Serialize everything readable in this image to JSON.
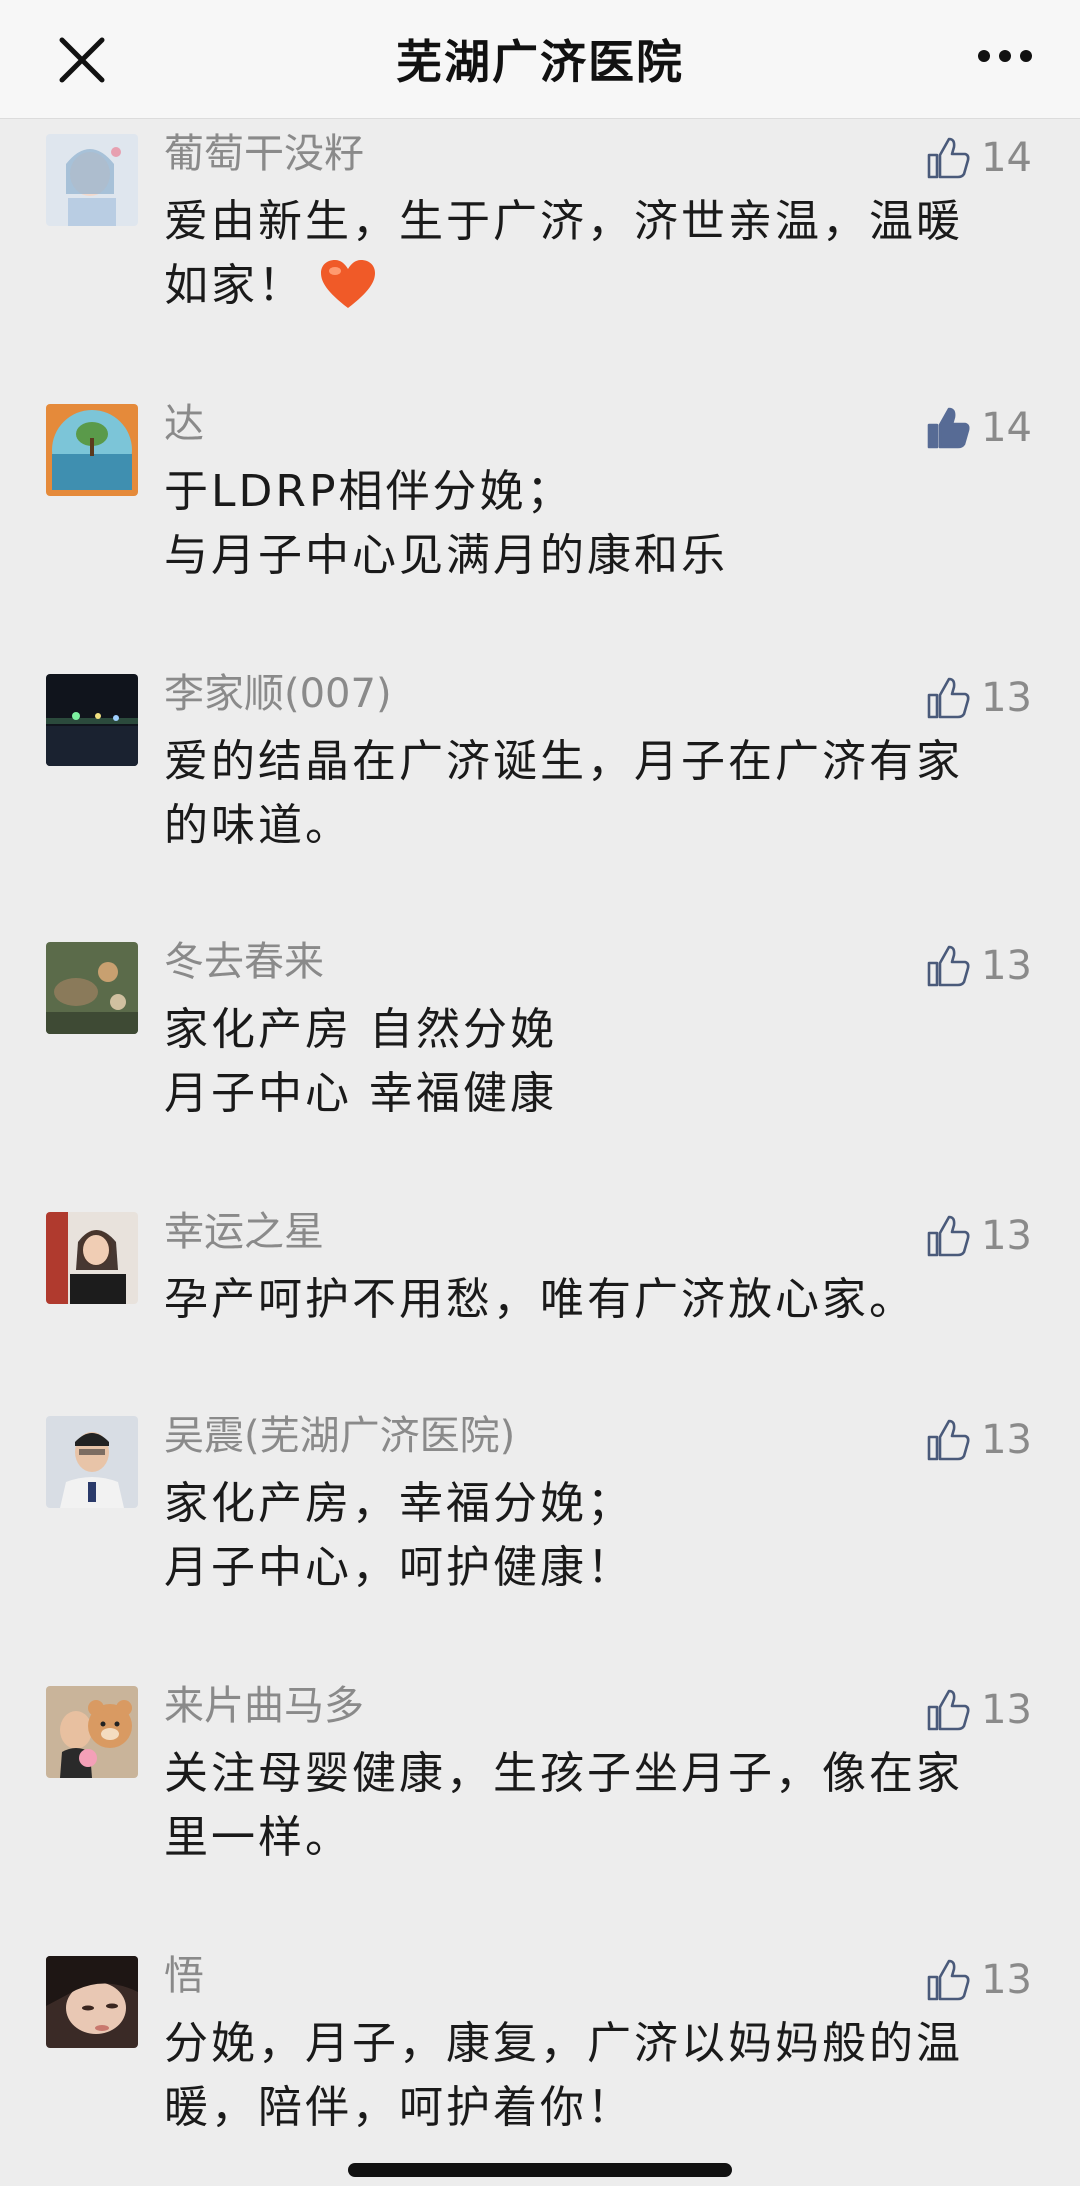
{
  "header": {
    "title": "芜湖广济医院",
    "close_icon": "close-icon",
    "more_icon": "more-dots-icon"
  },
  "colors": {
    "background": "#ededed",
    "header_bg": "#f7f7f7",
    "like_icon": "#4a5a7a",
    "liked_icon": "#576b95",
    "heart": "#f05a28"
  },
  "comments": [
    {
      "name": "葡萄干没籽",
      "likes": "14",
      "liked": false,
      "lines": [
        "爱由新生，生于广济，济世亲温，温暖",
        "如家！"
      ],
      "emoji": "heart"
    },
    {
      "name": "达",
      "likes": "14",
      "liked": true,
      "lines": [
        "于LDRP相伴分娩；",
        "与月子中心见满月的康和乐"
      ]
    },
    {
      "name": "李家顺(007)",
      "likes": "13",
      "liked": false,
      "lines": [
        "爱的结晶在广济诞生，月子在广济有家",
        "的味道。"
      ]
    },
    {
      "name": "冬去春来",
      "likes": "13",
      "liked": false,
      "lines": [
        "家化产房 自然分娩",
        "月子中心 幸福健康"
      ]
    },
    {
      "name": "幸运之星",
      "likes": "13",
      "liked": false,
      "lines": [
        "孕产呵护不用愁，唯有广济放心家。"
      ]
    },
    {
      "name": "吴震(芜湖广济医院)",
      "likes": "13",
      "liked": false,
      "lines": [
        "家化产房，幸福分娩；",
        "月子中心，呵护健康！"
      ]
    },
    {
      "name": "来片曲马多",
      "likes": "13",
      "liked": false,
      "lines": [
        "关注母婴健康，生孩子坐月子，像在家",
        "里一样。"
      ]
    },
    {
      "name": "悟",
      "likes": "13",
      "liked": false,
      "lines": [
        "分娩，月子，康复，广济以妈妈般的温",
        "暖，陪伴，呵护着你！"
      ]
    }
  ]
}
